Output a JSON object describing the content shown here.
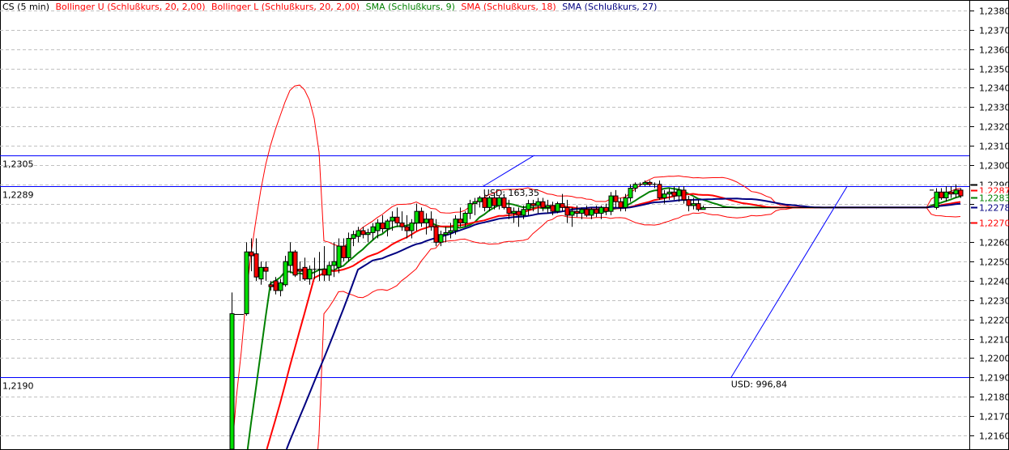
{
  "chart_data": {
    "type": "candlestick",
    "title": "CS (5 min)",
    "legend": [
      {
        "label": "CS (5 min)",
        "color": "#000000"
      },
      {
        "label": "Bollinger U (Schlußkurs, 20, 2,00)",
        "color": "#ff0000"
      },
      {
        "label": "Bollinger L (Schlußkurs, 20, 2,00)",
        "color": "#ff0000"
      },
      {
        "label": "SMA (Schlußkurs, 9)",
        "color": "#008000"
      },
      {
        "label": "SMA (Schlußkurs, 18)",
        "color": "#ff0000"
      },
      {
        "label": "SMA (Schlußkurs, 27)",
        "color": "#000080"
      }
    ],
    "indicators": {
      "bollinger": {
        "period": 20,
        "mult": 2,
        "color": "#ff0000"
      },
      "sma": [
        {
          "period": 9,
          "color": "#008000"
        },
        {
          "period": 18,
          "color": "#ff0000"
        },
        {
          "period": 27,
          "color": "#000080"
        }
      ]
    },
    "prior_close": 1.208,
    "ylim": [
      1.2155,
      1.2385
    ],
    "y_ticks": [
      "1,2380",
      "1,2370",
      "1,2360",
      "1,2350",
      "1,2340",
      "1,2330",
      "1,2320",
      "1,2310",
      "1,2300",
      "1,2290",
      "1,2280",
      "1,2270",
      "1,2260",
      "1,2250",
      "1,2240",
      "1,2230",
      "1,2220",
      "1,2210",
      "1,2200",
      "1,2190",
      "1,2180",
      "1,2170",
      "1,2160"
    ],
    "y_tick_values": [
      1.238,
      1.237,
      1.236,
      1.235,
      1.234,
      1.233,
      1.232,
      1.231,
      1.23,
      1.229,
      1.228,
      1.227,
      1.226,
      1.225,
      1.224,
      1.223,
      1.222,
      1.221,
      1.22,
      1.219,
      1.218,
      1.217,
      1.216
    ],
    "last_values": [
      {
        "label": "1,2290",
        "value": 1.229,
        "color": "#000000"
      },
      {
        "label": "1,2287",
        "value": 1.2287,
        "color": "#ff0000"
      },
      {
        "label": "1,2283",
        "value": 1.2283,
        "color": "#008000"
      },
      {
        "label": "1,2278",
        "value": 1.2278,
        "color": "#000080"
      },
      {
        "label": "1,2270",
        "value": 1.227,
        "color": "#ff0000"
      }
    ],
    "horizontal_lines": [
      {
        "value": 1.2305,
        "label": "1,2305",
        "color": "#0000ff"
      },
      {
        "value": 1.2289,
        "label": "1,2289",
        "color": "#0000ff"
      },
      {
        "value": 1.219,
        "label": "1,2190",
        "color": "#0000ff"
      }
    ],
    "trendlines": [
      {
        "from": [
          51.8,
          1.2289
        ],
        "to": [
          62.3,
          1.2305
        ],
        "label": "USD: 163,35",
        "color": "#0000ff"
      },
      {
        "from": [
          102.8,
          1.219
        ],
        "to": [
          126.7,
          1.2289
        ],
        "label": "USD: 996,84",
        "color": "#0000ff"
      }
    ],
    "candles": [
      [
        1.208,
        1.2234,
        1.208,
        1.2223
      ],
      null,
      null,
      [
        1.2223,
        1.226,
        1.2222,
        1.2255
      ],
      [
        1.2255,
        1.2262,
        1.2245,
        1.2253
      ],
      [
        1.2254,
        1.2262,
        1.224,
        1.2242
      ],
      [
        1.2241,
        1.225,
        1.2238,
        1.2247
      ],
      [
        1.2247,
        1.225,
        1.224,
        1.2245
      ],
      [
        1.2238,
        1.224,
        1.2235,
        1.2237
      ],
      [
        1.224,
        1.2242,
        1.2233,
        1.2235
      ],
      [
        1.2235,
        1.2241,
        1.2232,
        1.2239
      ],
      [
        1.2238,
        1.2253,
        1.2237,
        1.225
      ],
      [
        1.2248,
        1.226,
        1.2244,
        1.2255
      ],
      [
        1.2255,
        1.2256,
        1.2242,
        1.2243
      ],
      [
        1.2246,
        1.225,
        1.224,
        1.2245
      ],
      [
        1.2247,
        1.2252,
        1.224,
        1.2241
      ],
      [
        1.2241,
        1.2248,
        1.2238,
        1.2246
      ],
      [
        1.2246,
        1.2252,
        1.2241,
        1.2246
      ],
      [
        1.2246,
        1.2255,
        1.224,
        1.2246
      ],
      [
        1.2246,
        1.2258,
        1.224,
        1.2243
      ],
      [
        1.2243,
        1.225,
        1.224,
        1.2248
      ],
      [
        1.2248,
        1.226,
        1.2242,
        1.225
      ],
      [
        1.2247,
        1.2262,
        1.2244,
        1.2258
      ],
      [
        1.2258,
        1.2262,
        1.225,
        1.2252
      ],
      [
        1.2252,
        1.2265,
        1.225,
        1.2262
      ],
      [
        1.2262,
        1.2266,
        1.2258,
        1.2264
      ],
      [
        1.2263,
        1.2268,
        1.226,
        1.2266
      ],
      [
        1.2266,
        1.2268,
        1.2262,
        1.2264
      ],
      [
        1.2264,
        1.2267,
        1.226,
        1.2265
      ],
      [
        1.2265,
        1.227,
        1.2261,
        1.2268
      ],
      [
        1.2266,
        1.2272,
        1.2262,
        1.227
      ],
      [
        1.227,
        1.2274,
        1.2265,
        1.2267
      ],
      [
        1.2267,
        1.2272,
        1.2263,
        1.2271
      ],
      [
        1.2271,
        1.2276,
        1.2266,
        1.2273
      ],
      [
        1.2273,
        1.2278,
        1.2268,
        1.227
      ],
      [
        1.227,
        1.2276,
        1.2266,
        1.2268
      ],
      [
        1.2268,
        1.2274,
        1.2262,
        1.2266
      ],
      [
        1.2266,
        1.2272,
        1.2262,
        1.227
      ],
      [
        1.227,
        1.228,
        1.2266,
        1.2276
      ],
      [
        1.2276,
        1.2278,
        1.2268,
        1.227
      ],
      [
        1.227,
        1.2275,
        1.2264,
        1.2272
      ],
      [
        1.2272,
        1.2276,
        1.2266,
        1.2268
      ],
      [
        1.2268,
        1.2272,
        1.2258,
        1.226
      ],
      [
        1.226,
        1.2266,
        1.2258,
        1.2264
      ],
      [
        1.2264,
        1.2268,
        1.226,
        1.2265
      ],
      [
        1.2265,
        1.227,
        1.2262,
        1.2266
      ],
      [
        1.2266,
        1.2274,
        1.2264,
        1.2272
      ],
      [
        1.2272,
        1.2278,
        1.2268,
        1.227
      ],
      [
        1.227,
        1.2276,
        1.2268,
        1.2275
      ],
      [
        1.2275,
        1.2282,
        1.2272,
        1.228
      ],
      [
        1.228,
        1.2283,
        1.2274,
        1.2281
      ],
      [
        1.2281,
        1.2284,
        1.2278,
        1.2283
      ],
      [
        1.2283,
        1.2285,
        1.2276,
        1.2278
      ],
      [
        1.2278,
        1.2284,
        1.2276,
        1.2283
      ],
      [
        1.2283,
        1.2285,
        1.2277,
        1.2279
      ],
      [
        1.2279,
        1.2284,
        1.2277,
        1.2283
      ],
      [
        1.2283,
        1.2285,
        1.2277,
        1.2278
      ],
      [
        1.2278,
        1.2282,
        1.2272,
        1.2275
      ],
      [
        1.2275,
        1.2278,
        1.227,
        1.2276
      ],
      [
        1.2276,
        1.2278,
        1.2268,
        1.2274
      ],
      [
        1.2274,
        1.2279,
        1.2272,
        1.2277
      ],
      [
        1.2277,
        1.2282,
        1.2274,
        1.228
      ],
      [
        1.228,
        1.2282,
        1.2276,
        1.2279
      ],
      [
        1.2279,
        1.2283,
        1.2275,
        1.2281
      ],
      [
        1.2281,
        1.2283,
        1.2276,
        1.2278
      ],
      [
        1.2278,
        1.2282,
        1.2275,
        1.2279
      ],
      [
        1.2279,
        1.2281,
        1.2274,
        1.2276
      ],
      [
        1.2276,
        1.2281,
        1.2275,
        1.228
      ],
      [
        1.228,
        1.2285,
        1.2276,
        1.2278
      ],
      [
        1.2278,
        1.2282,
        1.227,
        1.2274
      ],
      [
        1.2274,
        1.2278,
        1.2268,
        1.2276
      ],
      [
        1.2276,
        1.2279,
        1.2273,
        1.2275
      ],
      [
        1.2275,
        1.2278,
        1.2272,
        1.2277
      ],
      [
        1.2277,
        1.2279,
        1.2273,
        1.2274
      ],
      [
        1.2274,
        1.2278,
        1.2272,
        1.2277
      ],
      [
        1.2277,
        1.2279,
        1.2273,
        1.2275
      ],
      [
        1.2275,
        1.2279,
        1.2272,
        1.2278
      ],
      [
        1.2278,
        1.228,
        1.2274,
        1.2276
      ],
      [
        1.2276,
        1.2286,
        1.2274,
        1.2284
      ],
      [
        1.2284,
        1.2287,
        1.2278,
        1.2281
      ],
      [
        1.2281,
        1.2283,
        1.2276,
        1.2278
      ],
      [
        1.2278,
        1.2285,
        1.2276,
        1.2283
      ],
      [
        1.2283,
        1.229,
        1.2281,
        1.2288
      ],
      [
        1.2288,
        1.2291,
        1.2286,
        1.229
      ],
      [
        1.229,
        1.2291,
        1.2289,
        1.229
      ],
      [
        1.229,
        1.2292,
        1.2289,
        1.2291
      ],
      [
        1.2291,
        1.2292,
        1.2289,
        1.229
      ],
      [
        1.229,
        1.2291,
        1.2288,
        1.229
      ],
      [
        1.229,
        1.2292,
        1.2282,
        1.2283
      ],
      [
        1.2283,
        1.2287,
        1.228,
        1.2285
      ],
      [
        1.2285,
        1.2288,
        1.2282,
        1.2286
      ],
      [
        1.2286,
        1.2289,
        1.2282,
        1.2284
      ],
      [
        1.2284,
        1.2289,
        1.2281,
        1.2287
      ],
      [
        1.2287,
        1.2289,
        1.228,
        1.2282
      ],
      [
        1.2282,
        1.2284,
        1.2276,
        1.2279
      ],
      [
        1.2279,
        1.2283,
        1.2277,
        1.228
      ],
      [
        1.228,
        1.2282,
        1.2276,
        1.2277
      ],
      [
        1.2277,
        1.2279,
        1.2277,
        1.2278
      ],
      null,
      null,
      null,
      null,
      null,
      null,
      null,
      null,
      null,
      null,
      null,
      null,
      null,
      null,
      null,
      null,
      null,
      null,
      null,
      null,
      null,
      null,
      null,
      null,
      null,
      null,
      null,
      null,
      null,
      null,
      null,
      null,
      null,
      null,
      null,
      null,
      null,
      null,
      null,
      null,
      null,
      null,
      null,
      null,
      null,
      null,
      [
        1.2287,
        1.2287,
        1.2287,
        1.2287
      ],
      [
        1.2278,
        1.2288,
        1.2277,
        1.2286
      ],
      [
        1.2286,
        1.2288,
        1.2282,
        1.2283
      ],
      [
        1.2283,
        1.2289,
        1.2281,
        1.2286
      ],
      [
        1.2286,
        1.2289,
        1.2283,
        1.2285
      ],
      [
        1.2285,
        1.229,
        1.2283,
        1.2287
      ],
      [
        1.2287,
        1.2288,
        1.2283,
        1.2284
      ]
    ]
  }
}
